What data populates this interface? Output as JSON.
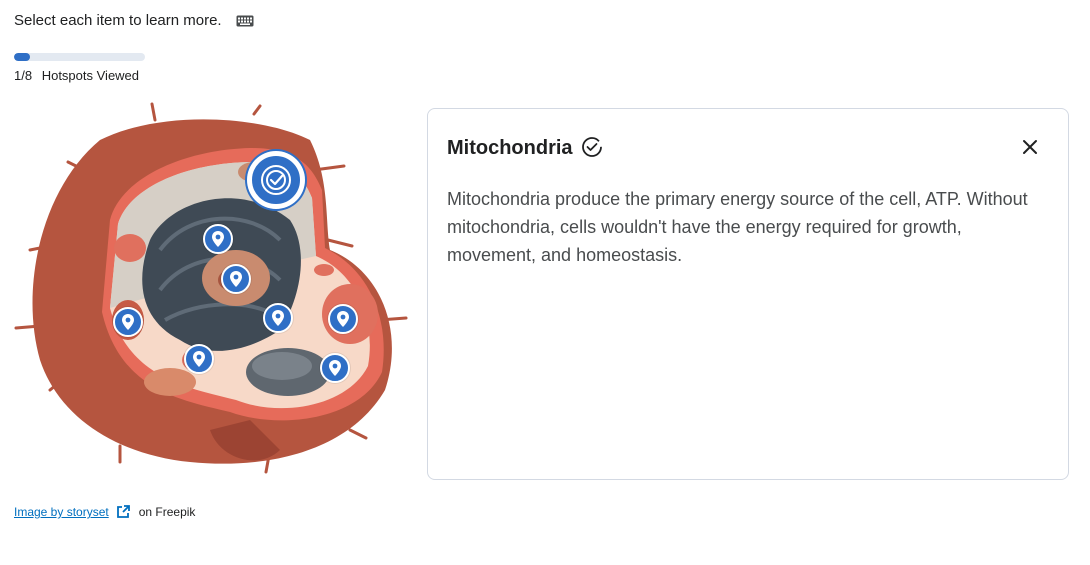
{
  "instructions": {
    "text": "Select each item to learn more.",
    "icon": "keyboard-icon"
  },
  "progress": {
    "viewed": 1,
    "total": 8,
    "fraction": 0.125,
    "count_label": "1/8",
    "label": "Hotspots Viewed"
  },
  "hotspots": [
    {
      "id": "mitochondria",
      "state": "viewed"
    },
    {
      "id": "hotspot-2",
      "state": "unviewed"
    },
    {
      "id": "hotspot-3",
      "state": "unviewed"
    },
    {
      "id": "hotspot-4",
      "state": "unviewed"
    },
    {
      "id": "hotspot-5",
      "state": "unviewed"
    },
    {
      "id": "hotspot-6",
      "state": "unviewed"
    },
    {
      "id": "hotspot-7",
      "state": "unviewed"
    },
    {
      "id": "hotspot-8",
      "state": "unviewed"
    }
  ],
  "panel": {
    "title": "Mitochondria",
    "body": "Mitochondria produce the primary energy source of the cell, ATP. Without mitochondria, cells wouldn't have the energy required for growth, movement, and homeostasis.",
    "close_icon": "close-icon",
    "viewed_icon": "check-circle-icon"
  },
  "credit": {
    "link_text": "Image by storyset",
    "suffix": "on Freepik",
    "icon": "external-link-icon"
  },
  "colors": {
    "accent": "#2f6fc6",
    "track": "#e3e9f1",
    "cell_outer": "#b5553f",
    "cell_inner": "#f0b9a0"
  }
}
